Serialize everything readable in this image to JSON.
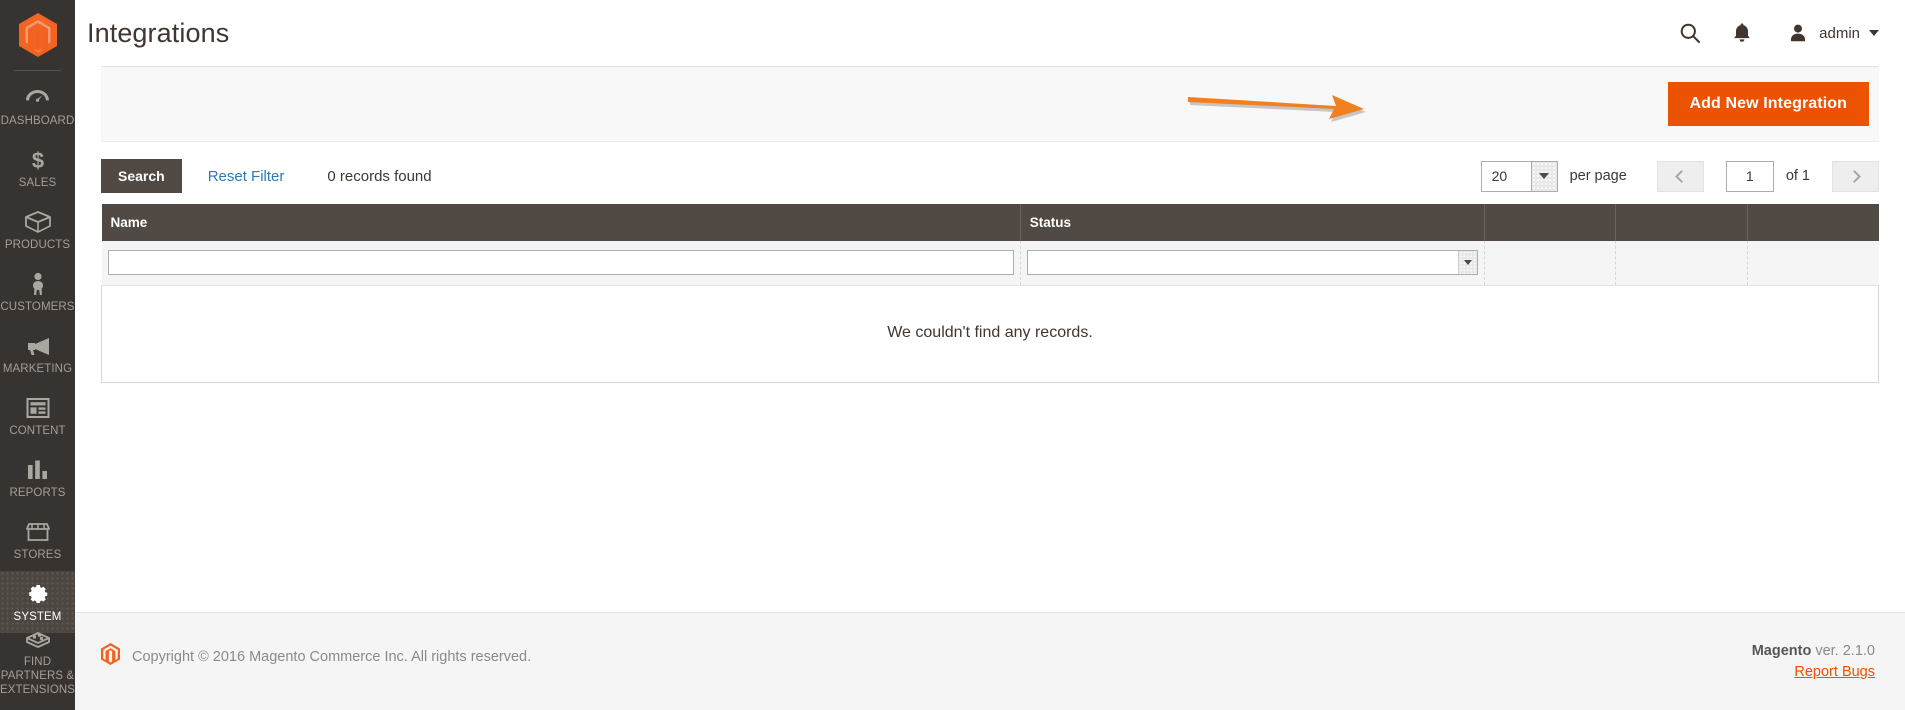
{
  "sidebar": {
    "logo_name": "magento-logo",
    "items": [
      {
        "label": "DASHBOARD",
        "icon": "dashboard-icon",
        "active": false
      },
      {
        "label": "SALES",
        "icon": "dollar-icon",
        "active": false
      },
      {
        "label": "PRODUCTS",
        "icon": "box-icon",
        "active": false
      },
      {
        "label": "CUSTOMERS",
        "icon": "person-icon",
        "active": false
      },
      {
        "label": "MARKETING",
        "icon": "megaphone-icon",
        "active": false
      },
      {
        "label": "CONTENT",
        "icon": "layout-icon",
        "active": false
      },
      {
        "label": "REPORTS",
        "icon": "bar-chart-icon",
        "active": false
      },
      {
        "label": "STORES",
        "icon": "storefront-icon",
        "active": false
      },
      {
        "label": "SYSTEM",
        "icon": "gear-icon",
        "active": true
      },
      {
        "label": "FIND PARTNERS & EXTENSIONS",
        "icon": "brick-icon",
        "active": false
      }
    ]
  },
  "header": {
    "title": "Integrations",
    "search_icon": "search-icon",
    "notifications_icon": "bell-icon",
    "admin_label": "admin"
  },
  "page_actions": {
    "add_new_label": "Add New Integration",
    "accent_color": "#eb5202",
    "annotation_arrow": "orange-arrow-pointing-right"
  },
  "grid_toolbar": {
    "search_label": "Search",
    "reset_filter_label": "Reset Filter",
    "records_found": "0 records found",
    "per_page_value": "20",
    "per_page_label": "per page",
    "prev_icon": "chevron-left-icon",
    "next_icon": "chevron-right-icon",
    "page_value": "1",
    "of_label": "of 1"
  },
  "grid": {
    "columns": [
      "Name",
      "Status",
      "",
      "",
      ""
    ],
    "filters": {
      "name_value": "",
      "name_placeholder": "",
      "status_value": ""
    },
    "empty_message": "We couldn't find any records.",
    "rows": []
  },
  "footer": {
    "logo_name": "magento-logo-small",
    "copyright": "Copyright © 2016 Magento Commerce Inc. All rights reserved.",
    "version_brand": "Magento",
    "version_text": " ver. 2.1.0",
    "report_bugs": "Report Bugs",
    "link_color": "#eb5202"
  }
}
